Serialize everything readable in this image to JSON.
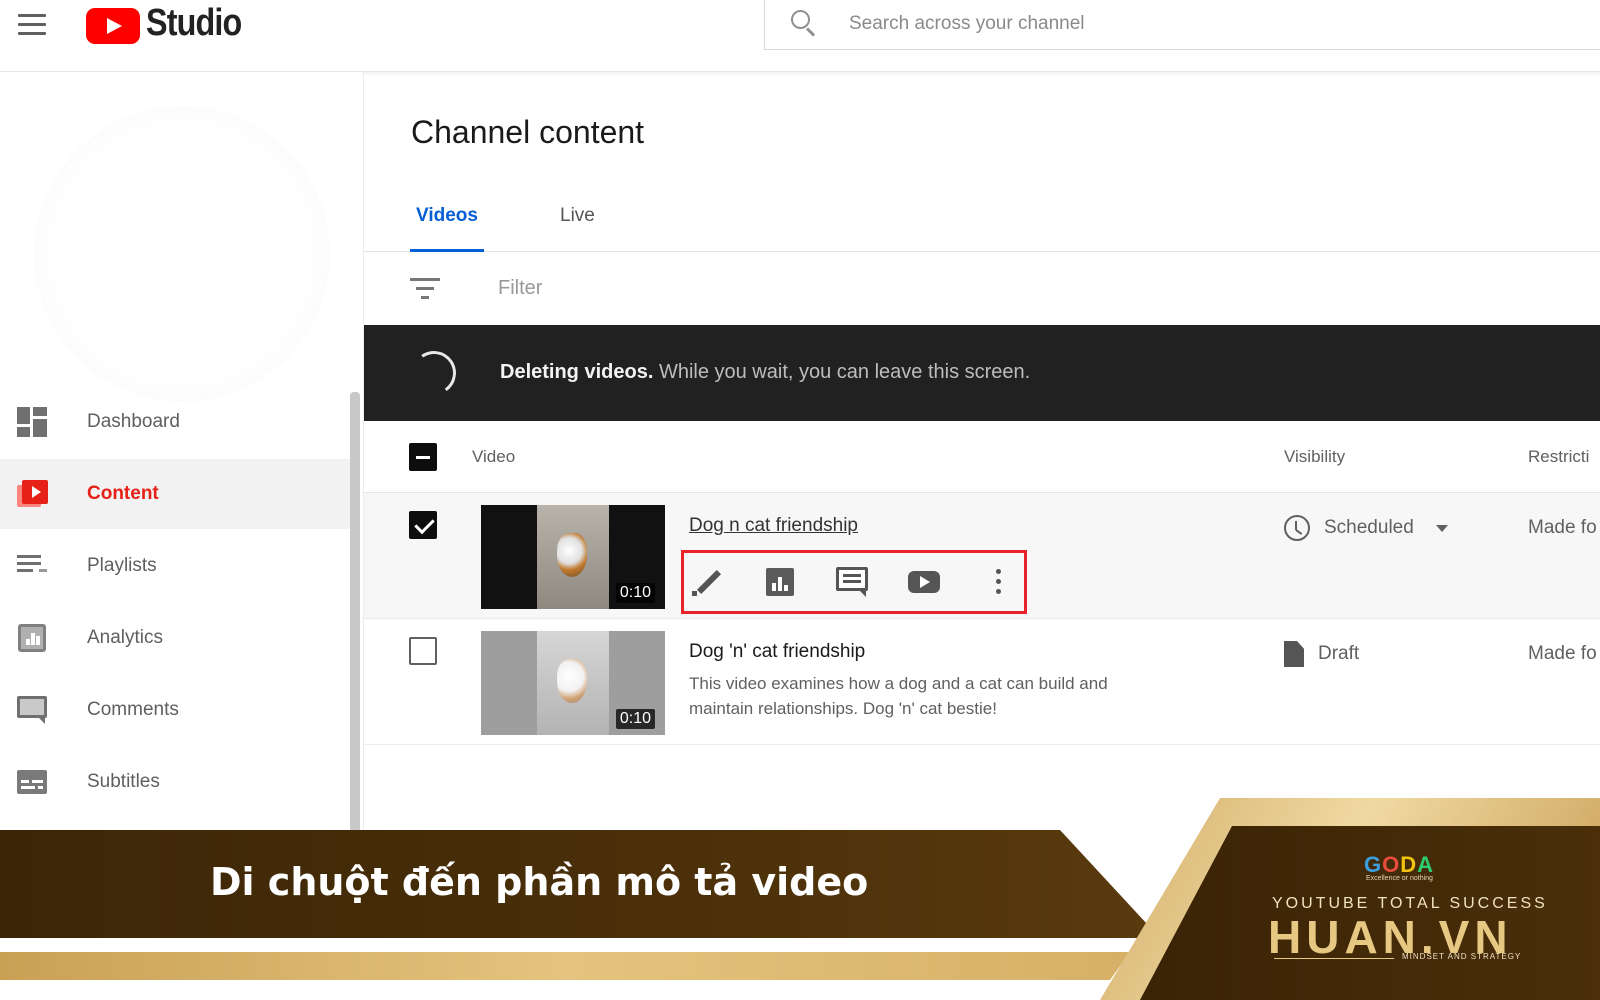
{
  "header": {
    "app_name": "Studio",
    "search": {
      "placeholder": "Search across your channel"
    }
  },
  "sidebar": {
    "items": [
      {
        "label": "Dashboard",
        "icon": "dashboard-icon"
      },
      {
        "label": "Content",
        "icon": "content-icon",
        "active": true
      },
      {
        "label": "Playlists",
        "icon": "playlists-icon"
      },
      {
        "label": "Analytics",
        "icon": "analytics-icon"
      },
      {
        "label": "Comments",
        "icon": "comments-icon"
      },
      {
        "label": "Subtitles",
        "icon": "subtitles-icon"
      }
    ]
  },
  "main": {
    "title": "Channel content",
    "tabs": [
      {
        "label": "Videos",
        "active": true
      },
      {
        "label": "Live"
      }
    ],
    "filter_label": "Filter",
    "snackbar": {
      "bold": "Deleting videos.",
      "rest": "While you wait, you can leave this screen."
    },
    "columns": {
      "video": "Video",
      "visibility": "Visibility",
      "restrictions": "Restricti"
    },
    "rows": [
      {
        "title": "Dog n cat friendship",
        "duration": "0:10",
        "visibility": "Scheduled",
        "restrictions": "Made fo",
        "checked": true
      },
      {
        "title": "Dog 'n' cat friendship",
        "description": "This video examines how a dog and a cat can build and maintain relationships. Dog 'n' cat bestie!",
        "duration": "0:10",
        "visibility": "Draft",
        "restrictions": "Made fo",
        "checked": false
      }
    ]
  },
  "banner": {
    "caption": "Di chuột đến phần mô tả video",
    "logo_letters": [
      "G",
      "O",
      "D",
      "A"
    ],
    "logo_tagline": "Excellence or nothing",
    "brand_tagline": "YOUTUBE TOTAL SUCCESS",
    "brand_name": "HUAN.VN",
    "brand_sub": "MINDSET AND STRATEGY"
  },
  "colors": {
    "accent_red": "#e62117",
    "tab_blue": "#065fd4",
    "highlight_box": "#e8242a",
    "banner_brown": "#4a2f09",
    "banner_gold": "#e4c47e"
  }
}
